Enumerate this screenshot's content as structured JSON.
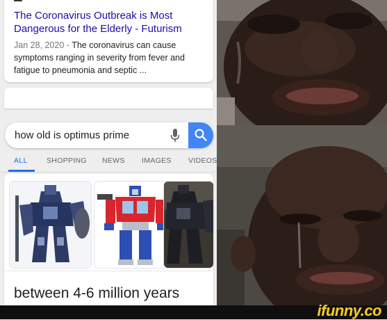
{
  "result": {
    "title": "The Coronavirus Outbreak is Most Dangerous for the Elderly - Futurism",
    "date": "Jan 28, 2020",
    "separator": "·",
    "snippet": "The coronavirus can cause symptoms ranging in severity from fever and fatigue to pneumonia and septic ..."
  },
  "search": {
    "query": "how old is optimus prime",
    "mic_icon": "mic-icon",
    "search_icon": "search-icon",
    "accent": "#4285f4"
  },
  "tabs": [
    {
      "label": "ALL",
      "active": true
    },
    {
      "label": "SHOPPING",
      "active": false
    },
    {
      "label": "NEWS",
      "active": false
    },
    {
      "label": "IMAGES",
      "active": false
    },
    {
      "label": "VIDEOS",
      "active": false
    }
  ],
  "answer": {
    "text": "between 4-6 million years"
  },
  "meme": {
    "watermark": "ifunny.co"
  },
  "colors": {
    "link": "#1a0dab",
    "active_tab": "#1a73e8",
    "watermark": "#ffcc22"
  }
}
